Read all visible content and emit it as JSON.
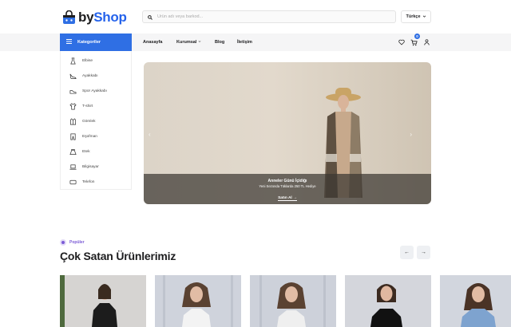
{
  "brand": {
    "prefix": "by",
    "name": "Shop",
    "accent": "#2f6fe4"
  },
  "search": {
    "placeholder": "Ürün adı veya barkod..."
  },
  "language": {
    "selected": "Türkçe"
  },
  "nav": {
    "categories_label": "Kategoriler",
    "links": [
      {
        "label": "Anasayfa"
      },
      {
        "label": "Kurumsal"
      },
      {
        "label": "Blog"
      },
      {
        "label": "İletişim"
      }
    ],
    "cart_count": "0"
  },
  "sidebar": {
    "items": [
      {
        "label": "Elbise",
        "icon": "dress-icon"
      },
      {
        "label": "Ayakkabı",
        "icon": "heel-shoe-icon"
      },
      {
        "label": "Spor Ayakkabı",
        "icon": "sneaker-icon"
      },
      {
        "label": "T-shirt",
        "icon": "tshirt-icon"
      },
      {
        "label": "Gömlek",
        "icon": "shirt-icon"
      },
      {
        "label": "Eşofman",
        "icon": "tracksuit-icon"
      },
      {
        "label": "Etek",
        "icon": "skirt-icon"
      },
      {
        "label": "Bilgisayar",
        "icon": "laptop-icon"
      },
      {
        "label": "Telefon",
        "icon": "phone-icon"
      }
    ]
  },
  "hero": {
    "title": "Anneler Günü İçidiğı",
    "subtitle": "Yeni Sezonda Tüklarda 250 TL Hediye",
    "cta": "Satın Al"
  },
  "popular": {
    "pill": "Popüler",
    "title": "Çok Satan Ürünlerimiz"
  }
}
